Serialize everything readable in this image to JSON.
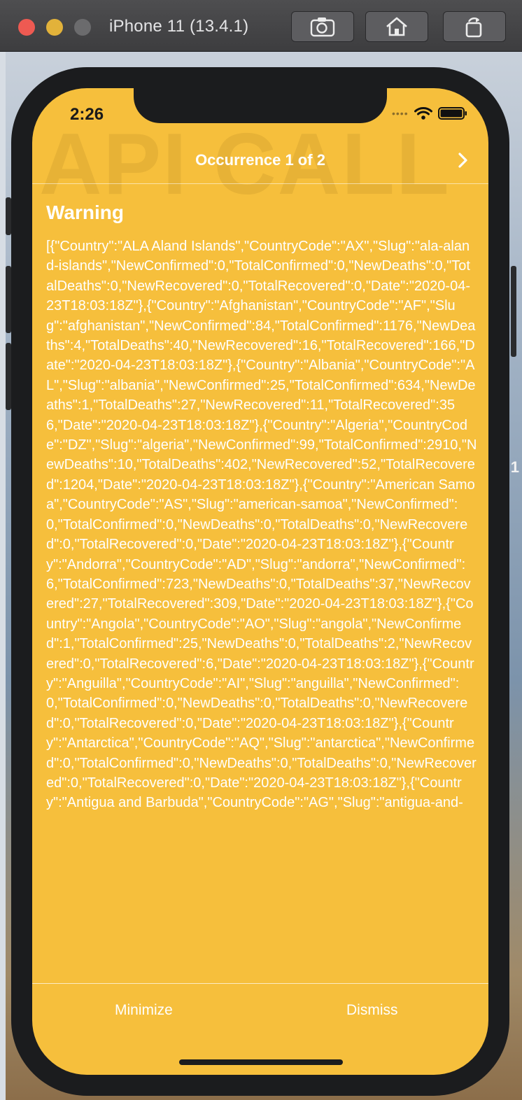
{
  "window": {
    "title": "iPhone 11 (13.4.1)",
    "buttons": [
      "screenshot-icon",
      "home-icon",
      "rotate-icon"
    ]
  },
  "status_bar": {
    "time": "2:26",
    "icons": [
      "cellular-icon",
      "wifi-icon",
      "battery-icon"
    ]
  },
  "backdrop": {
    "edge_digit": "1"
  },
  "alert": {
    "watermark": "API CALL",
    "nav_title": "Occurrence 1 of 2",
    "next_icon": "chevron-right-icon",
    "heading": "Warning",
    "message": "[{\"Country\":\"ALA Aland Islands\",\"CountryCode\":\"AX\",\"Slug\":\"ala-aland-islands\",\"NewConfirmed\":0,\"TotalConfirmed\":0,\"NewDeaths\":0,\"TotalDeaths\":0,\"NewRecovered\":0,\"TotalRecovered\":0,\"Date\":\"2020-04-23T18:03:18Z\"},{\"Country\":\"Afghanistan\",\"CountryCode\":\"AF\",\"Slug\":\"afghanistan\",\"NewConfirmed\":84,\"TotalConfirmed\":1176,\"NewDeaths\":4,\"TotalDeaths\":40,\"NewRecovered\":16,\"TotalRecovered\":166,\"Date\":\"2020-04-23T18:03:18Z\"},{\"Country\":\"Albania\",\"CountryCode\":\"AL\",\"Slug\":\"albania\",\"NewConfirmed\":25,\"TotalConfirmed\":634,\"NewDeaths\":1,\"TotalDeaths\":27,\"NewRecovered\":11,\"TotalRecovered\":356,\"Date\":\"2020-04-23T18:03:18Z\"},{\"Country\":\"Algeria\",\"CountryCode\":\"DZ\",\"Slug\":\"algeria\",\"NewConfirmed\":99,\"TotalConfirmed\":2910,\"NewDeaths\":10,\"TotalDeaths\":402,\"NewRecovered\":52,\"TotalRecovered\":1204,\"Date\":\"2020-04-23T18:03:18Z\"},{\"Country\":\"American Samoa\",\"CountryCode\":\"AS\",\"Slug\":\"american-samoa\",\"NewConfirmed\":0,\"TotalConfirmed\":0,\"NewDeaths\":0,\"TotalDeaths\":0,\"NewRecovered\":0,\"TotalRecovered\":0,\"Date\":\"2020-04-23T18:03:18Z\"},{\"Country\":\"Andorra\",\"CountryCode\":\"AD\",\"Slug\":\"andorra\",\"NewConfirmed\":6,\"TotalConfirmed\":723,\"NewDeaths\":0,\"TotalDeaths\":37,\"NewRecovered\":27,\"TotalRecovered\":309,\"Date\":\"2020-04-23T18:03:18Z\"},{\"Country\":\"Angola\",\"CountryCode\":\"AO\",\"Slug\":\"angola\",\"NewConfirmed\":1,\"TotalConfirmed\":25,\"NewDeaths\":0,\"TotalDeaths\":2,\"NewRecovered\":0,\"TotalRecovered\":6,\"Date\":\"2020-04-23T18:03:18Z\"},{\"Country\":\"Anguilla\",\"CountryCode\":\"AI\",\"Slug\":\"anguilla\",\"NewConfirmed\":0,\"TotalConfirmed\":0,\"NewDeaths\":0,\"TotalDeaths\":0,\"NewRecovered\":0,\"TotalRecovered\":0,\"Date\":\"2020-04-23T18:03:18Z\"},{\"Country\":\"Antarctica\",\"CountryCode\":\"AQ\",\"Slug\":\"antarctica\",\"NewConfirmed\":0,\"TotalConfirmed\":0,\"NewDeaths\":0,\"TotalDeaths\":0,\"NewRecovered\":0,\"TotalRecovered\":0,\"Date\":\"2020-04-23T18:03:18Z\"},{\"Country\":\"Antigua and Barbuda\",\"CountryCode\":\"AG\",\"Slug\":\"antigua-and-",
    "minimize_label": "Minimize",
    "dismiss_label": "Dismiss",
    "colors": {
      "background": "#f6bf3c",
      "text": "#ffffff"
    }
  }
}
